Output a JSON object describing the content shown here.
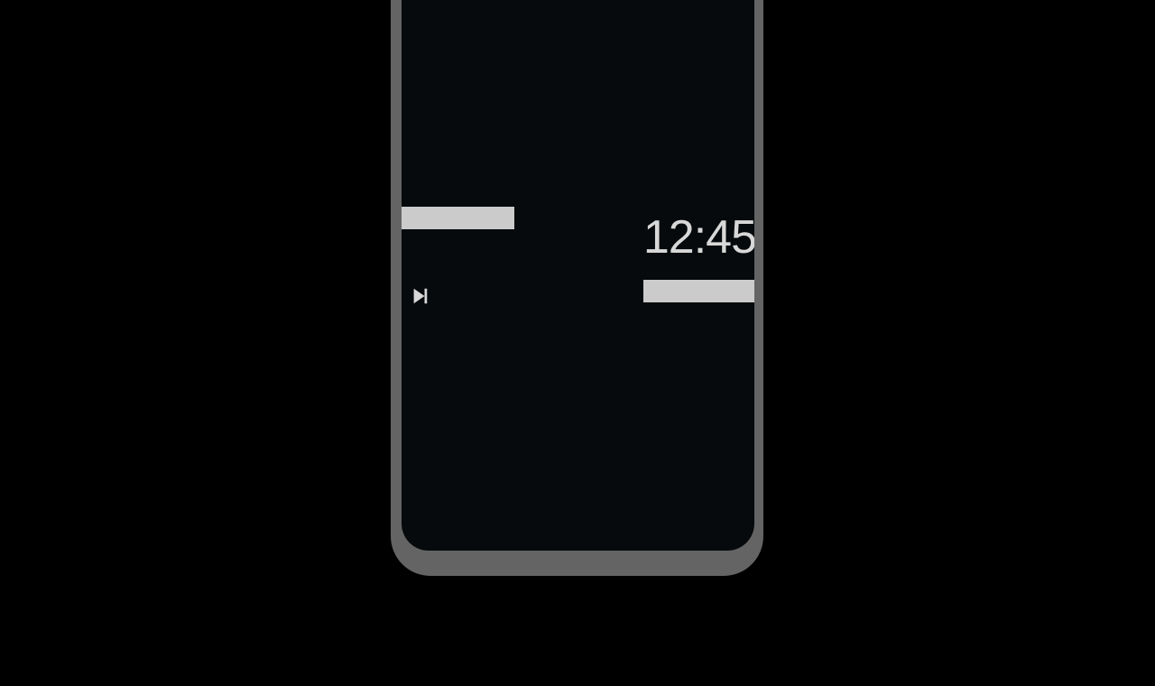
{
  "screen": {
    "clock": {
      "time": "12:45"
    },
    "media_control": {
      "icon": "skip-next-icon"
    }
  },
  "colors": {
    "background": "#000000",
    "frame": "#646464",
    "screen": "#060a0c",
    "placeholder": "#cbcbcb",
    "text": "#d8d8d8"
  }
}
